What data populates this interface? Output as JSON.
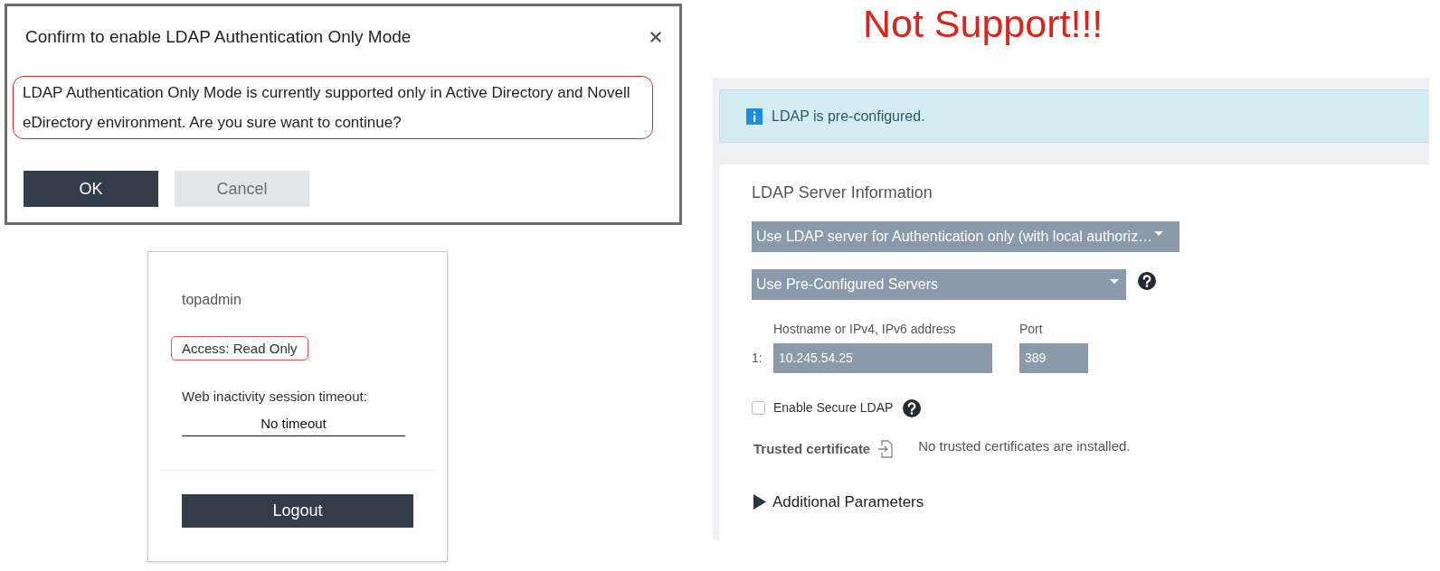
{
  "annotation": {
    "text": "Not Support!!!"
  },
  "confirm_dialog": {
    "title": "Confirm to enable LDAP Authentication Only Mode",
    "message": "LDAP Authentication Only Mode is currently supported only in Active Directory and Novell eDirectory environment. Are you sure want to continue?",
    "message_highlighted": true,
    "buttons": [
      {
        "label": "OK",
        "kind": "primary"
      },
      {
        "label": "Cancel",
        "kind": "secondary"
      }
    ]
  },
  "user_menu": {
    "username": "topadmin",
    "access": {
      "text": "Access: Read Only",
      "highlighted": true
    },
    "timeout_label": "Web inactivity session timeout:",
    "timeout_value": "No timeout",
    "logout": "Logout"
  },
  "ldap_panel": {
    "alert": "LDAP is pre-configured.",
    "title": "LDAP Server Information",
    "mode_select": "Use LDAP server for Authentication only (with local authoriz…",
    "server_select": "Use Pre-Configured Servers",
    "servers": {
      "columns": [
        "Hostname or IPv4, IPv6 address",
        "Port"
      ],
      "rows": [
        {
          "index": "1:",
          "host": "10.245.54.25",
          "port": "389"
        }
      ]
    },
    "secure_ldap": {
      "label": "Enable Secure LDAP",
      "checked": false
    },
    "trusted_certificate": {
      "label": "Trusted certificate",
      "value": "No trusted certificates are installed."
    },
    "additional_parameters": {
      "label": "Additional Parameters",
      "expanded": false
    }
  }
}
